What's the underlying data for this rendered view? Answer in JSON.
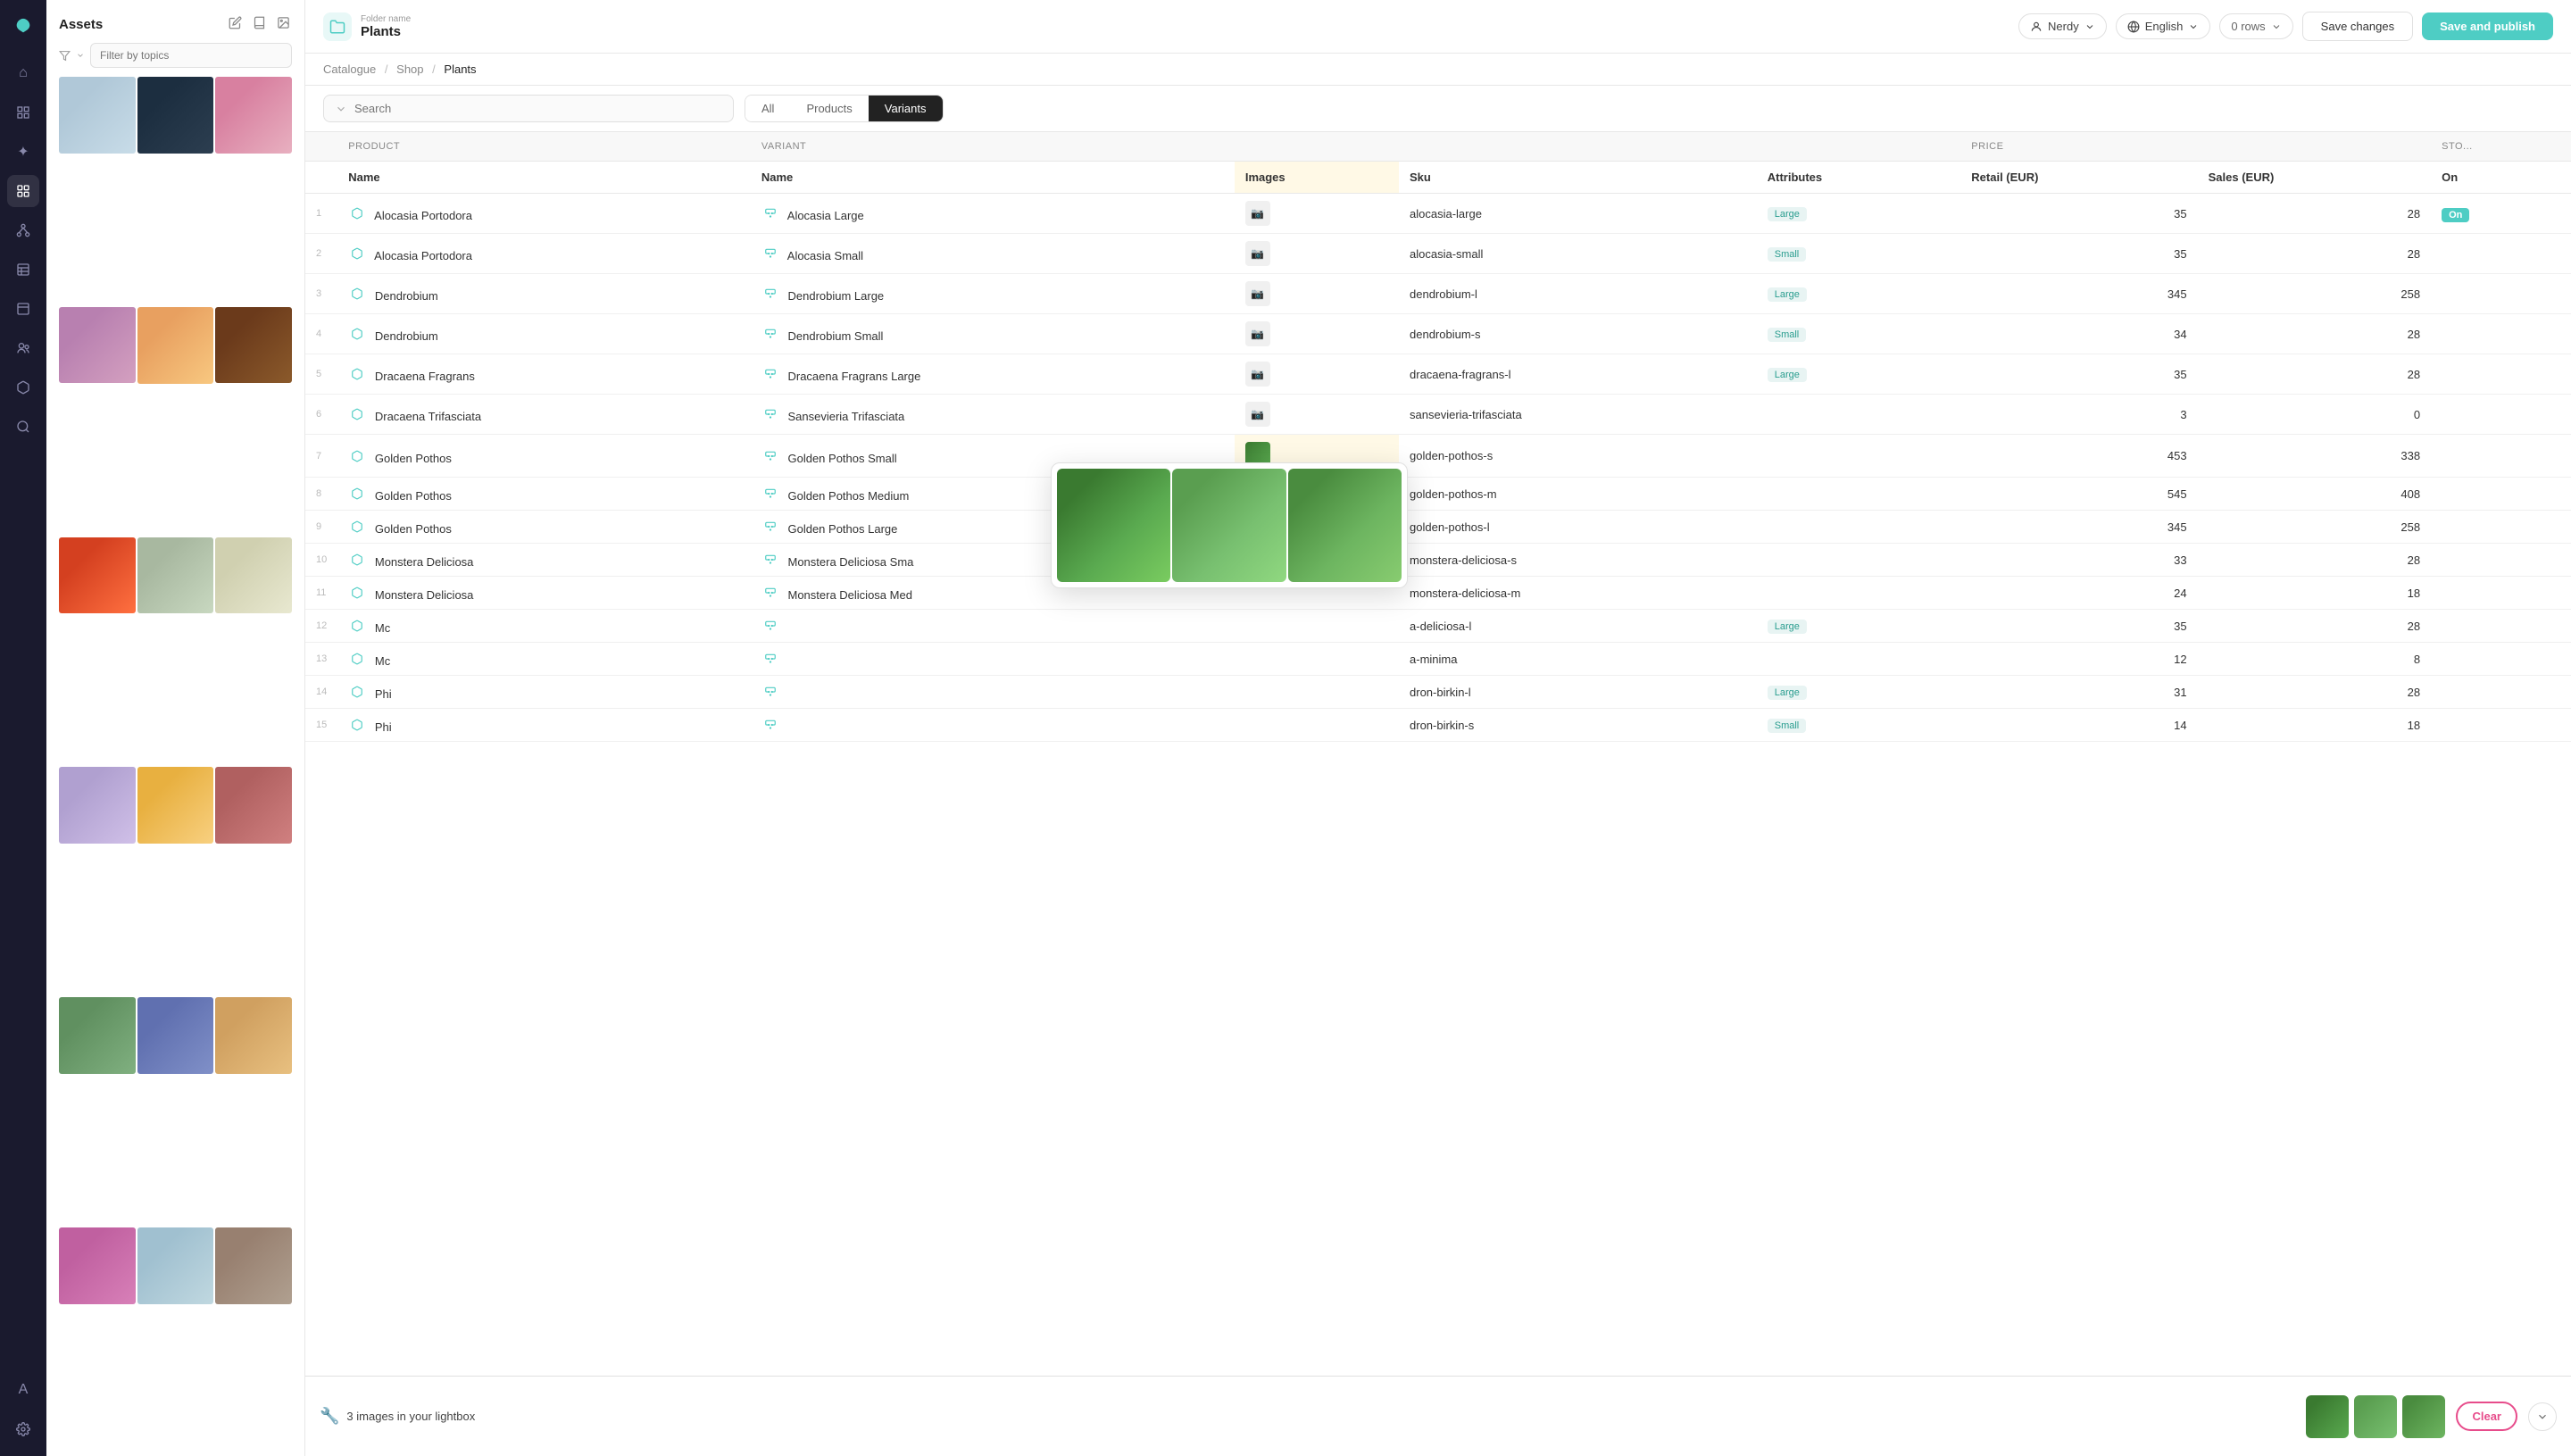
{
  "app": {
    "logo": "🌿"
  },
  "sidebar_icons": [
    {
      "name": "home-icon",
      "icon": "⌂",
      "active": false
    },
    {
      "name": "layers-icon",
      "icon": "⊞",
      "active": false
    },
    {
      "name": "sparkle-icon",
      "icon": "✦",
      "active": false
    },
    {
      "name": "grid-icon",
      "icon": "▦",
      "active": true
    },
    {
      "name": "nodes-icon",
      "icon": "◎",
      "active": false
    },
    {
      "name": "grid2-icon",
      "icon": "⊡",
      "active": false
    },
    {
      "name": "preview-icon",
      "icon": "⊟",
      "active": false
    },
    {
      "name": "users-icon",
      "icon": "👥",
      "active": false
    },
    {
      "name": "box-icon",
      "icon": "⬡",
      "active": false
    },
    {
      "name": "search2-icon",
      "icon": "🔍",
      "active": false
    },
    {
      "name": "text-icon",
      "icon": "A",
      "active": false
    },
    {
      "name": "settings-icon",
      "icon": "⚙",
      "active": false
    }
  ],
  "assets": {
    "title": "Assets",
    "filter_placeholder": "Filter by topics",
    "images": [
      {
        "color": "image-color-1",
        "desc": "phone white"
      },
      {
        "color": "image-color-2",
        "desc": "phone black"
      },
      {
        "color": "image-color-3",
        "desc": "flower pink"
      },
      {
        "color": "image-color-4",
        "desc": "flower purple"
      },
      {
        "color": "image-color-5",
        "desc": "flower orange"
      },
      {
        "color": "image-color-6",
        "desc": "dark plant"
      },
      {
        "color": "image-color-7",
        "desc": "tulips orange"
      },
      {
        "color": "image-color-8",
        "desc": "green flower"
      },
      {
        "color": "image-color-9",
        "desc": "white flower"
      },
      {
        "color": "image-color-10",
        "desc": "purple flower"
      },
      {
        "color": "image-color-11",
        "desc": "yellow flower"
      },
      {
        "color": "image-color-12",
        "desc": "red flower"
      },
      {
        "color": "image-color-13",
        "desc": "plant cosmos"
      },
      {
        "color": "image-color-14",
        "desc": "purple group"
      },
      {
        "color": "image-color-15",
        "desc": "yellow tulips"
      },
      {
        "color": "image-color-16",
        "desc": "orchid pink"
      },
      {
        "color": "image-color-17",
        "desc": "red flower2"
      },
      {
        "color": "image-color-18",
        "desc": "sunflower"
      }
    ]
  },
  "header": {
    "folder_label": "Folder name",
    "folder_name": "Plants",
    "persona_label": "Nerdy",
    "language_label": "English",
    "rows_label": "0 rows",
    "save_changes_label": "Save changes",
    "save_publish_label": "Save and publish"
  },
  "breadcrumb": {
    "path": [
      "Catalogue",
      "Shop",
      "Plants"
    ]
  },
  "toolbar": {
    "search_placeholder": "Search",
    "tabs": [
      {
        "label": "All",
        "active": false
      },
      {
        "label": "Products",
        "active": false
      },
      {
        "label": "Variants",
        "active": true
      }
    ]
  },
  "table": {
    "product_header": "Product",
    "variant_header": "Variant",
    "price_header": "Price",
    "stock_header": "Sto",
    "col_name": "Name",
    "col_variant_name": "Name",
    "col_images": "Images",
    "col_sku": "Sku",
    "col_attributes": "Attributes",
    "col_retail": "Retail (EUR)",
    "col_sales": "Sales (EUR)",
    "col_on": "On",
    "rows": [
      {
        "num": 1,
        "product": "Alocasia Portodora",
        "variant": "Alocasia Large",
        "sku": "alocasia-large",
        "attr": "Large",
        "retail": 35,
        "sales": 28
      },
      {
        "num": 2,
        "product": "Alocasia Portodora",
        "variant": "Alocasia Small",
        "sku": "alocasia-small",
        "attr": "Small",
        "retail": 35,
        "sales": 28
      },
      {
        "num": 3,
        "product": "Dendrobium",
        "variant": "Dendrobium Large",
        "sku": "dendrobium-l",
        "attr": "Large",
        "retail": 345,
        "sales": 258
      },
      {
        "num": 4,
        "product": "Dendrobium",
        "variant": "Dendrobium Small",
        "sku": "dendrobium-s",
        "attr": "Small",
        "retail": 34,
        "sales": 28
      },
      {
        "num": 5,
        "product": "Dracaena Fragrans",
        "variant": "Dracaena Fragrans Large",
        "sku": "dracaena-fragrans-l",
        "attr": "Large",
        "retail": 35,
        "sales": 28
      },
      {
        "num": 6,
        "product": "Dracaena Trifasciata",
        "variant": "Sansevieria Trifasciata",
        "sku": "sansevieria-trifasciata",
        "attr": "",
        "retail": 3,
        "sales": 0
      },
      {
        "num": 7,
        "product": "Golden Pothos",
        "variant": "Golden Pothos Small",
        "sku": "golden-pothos-s",
        "attr": "",
        "retail": 453,
        "sales": 338,
        "has_images": true
      },
      {
        "num": 8,
        "product": "Golden Pothos",
        "variant": "Golden Pothos Medium",
        "sku": "golden-pothos-m",
        "attr": "",
        "retail": 545,
        "sales": 408
      },
      {
        "num": 9,
        "product": "Golden Pothos",
        "variant": "Golden Pothos Large",
        "sku": "golden-pothos-l",
        "attr": "",
        "retail": 345,
        "sales": 258
      },
      {
        "num": 10,
        "product": "Monstera Deliciosa",
        "variant": "Monstera Deliciosa Sma",
        "sku": "monstera-deliciosa-s",
        "attr": "",
        "retail": 33,
        "sales": 28
      },
      {
        "num": 11,
        "product": "Monstera Deliciosa",
        "variant": "Monstera Deliciosa Med",
        "sku": "monstera-deliciosa-m",
        "attr": "",
        "retail": 24,
        "sales": 18
      },
      {
        "num": 12,
        "product": "Mc",
        "variant": "",
        "sku": "a-deliciosa-l",
        "attr": "Large",
        "retail": 35,
        "sales": 28
      },
      {
        "num": 13,
        "product": "Mc",
        "variant": "",
        "sku": "a-minima",
        "attr": "",
        "retail": 12,
        "sales": 8
      },
      {
        "num": 14,
        "product": "Phi",
        "variant": "",
        "sku": "dron-birkin-l",
        "attr": "Large",
        "retail": 31,
        "sales": 28
      },
      {
        "num": 15,
        "product": "Phi",
        "variant": "",
        "sku": "dron-birkin-s",
        "attr": "Small",
        "retail": 14,
        "sales": 18
      }
    ]
  },
  "image_popup": {
    "images": [
      {
        "color": "plant-green-1",
        "desc": "pothos natural"
      },
      {
        "color": "plant-green-2",
        "desc": "pothos pot"
      },
      {
        "color": "plant-green-3",
        "desc": "pothos stand"
      }
    ]
  },
  "lightbox": {
    "icon": "🔧",
    "text": "3 images in your lightbox",
    "clear_label": "Clear",
    "thumbs": [
      {
        "color": "plant-green-1",
        "desc": "thumb 1"
      },
      {
        "color": "plant-green-2",
        "desc": "thumb 2"
      },
      {
        "color": "plant-green-3",
        "desc": "thumb 3"
      }
    ]
  }
}
